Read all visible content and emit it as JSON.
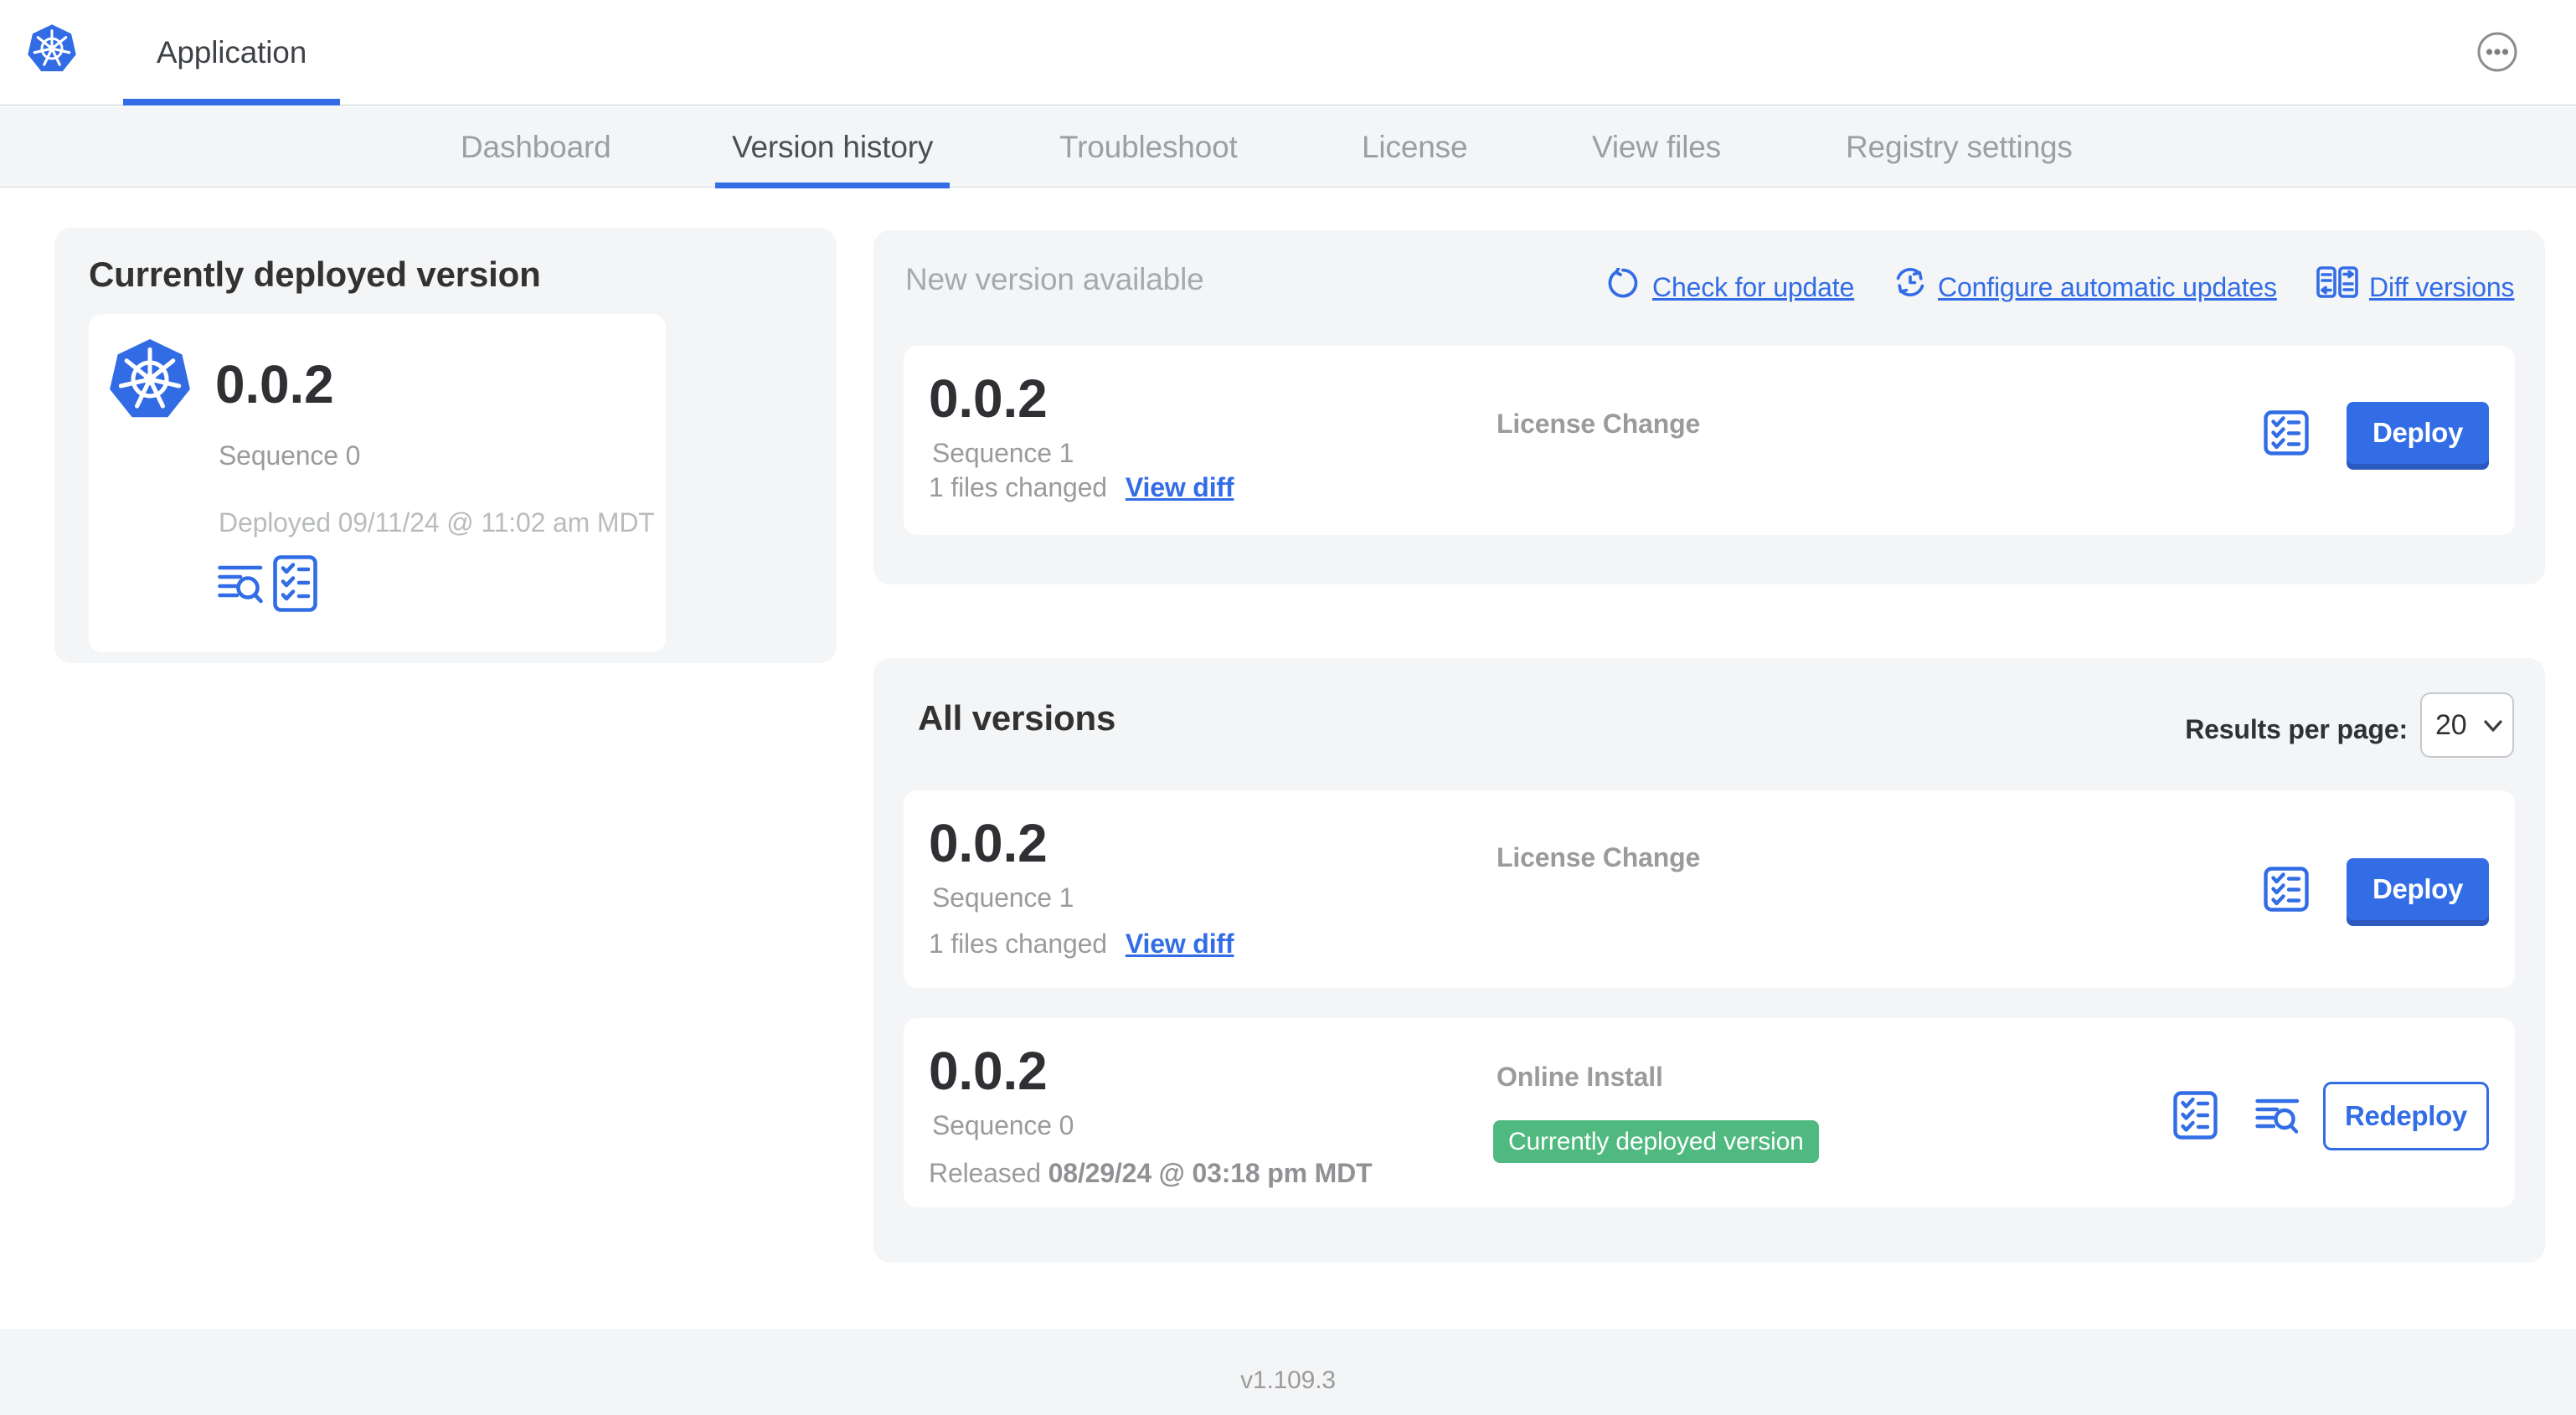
{
  "header": {
    "app_tab": "Application"
  },
  "nav": {
    "tabs": [
      {
        "label": "Dashboard",
        "active": false
      },
      {
        "label": "Version history",
        "active": true
      },
      {
        "label": "Troubleshoot",
        "active": false
      },
      {
        "label": "License",
        "active": false
      },
      {
        "label": "View files",
        "active": false
      },
      {
        "label": "Registry settings",
        "active": false
      }
    ]
  },
  "deployed_panel": {
    "heading": "Currently deployed version",
    "version": "0.0.2",
    "sequence": "Sequence 0",
    "deployed_at": "Deployed 09/11/24 @ 11:02 am MDT"
  },
  "new_version_panel": {
    "heading": "New version available",
    "check_for_update": "Check for update",
    "configure_updates": "Configure automatic updates",
    "diff_versions": "Diff versions",
    "row": {
      "version": "0.0.2",
      "sequence": "Sequence 1",
      "files_changed": "1 files changed",
      "view_diff": "View diff",
      "source": "License Change",
      "action_label": "Deploy"
    }
  },
  "all_versions_panel": {
    "heading": "All versions",
    "results_per_page_label": "Results per page:",
    "results_per_page_value": "20",
    "rows": [
      {
        "version": "0.0.2",
        "sequence": "Sequence 1",
        "files_changed": "1 files changed",
        "view_diff": "View diff",
        "source": "License Change",
        "action_label": "Deploy"
      },
      {
        "version": "0.0.2",
        "sequence": "Sequence 0",
        "released_label": "Released",
        "released_date": "08/29/24 @ 03:18 pm MDT",
        "source": "Online Install",
        "badge": "Currently deployed version",
        "action_label": "Redeploy"
      }
    ]
  },
  "footer": {
    "version": "v1.109.3"
  },
  "colors": {
    "primary_blue": "#326de6",
    "kubernetes_blue": "#326ce5",
    "badge_green": "#4fb97f",
    "panel_gray": "#f4f5f7",
    "text_dark": "#323232",
    "text_gray": "#9b9b9b",
    "text_light_gray": "#b9bcbf"
  }
}
